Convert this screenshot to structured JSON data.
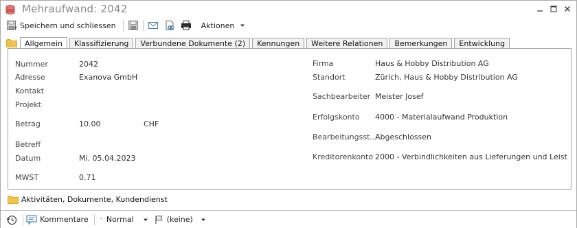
{
  "window": {
    "title": "Mehraufwand: 2042"
  },
  "toolbar": {
    "save_close_label": "Speichern und schliessen",
    "actions_label": "Aktionen"
  },
  "tabs": [
    {
      "label": "Allgemein",
      "active": true
    },
    {
      "label": "Klassifizierung"
    },
    {
      "label": "Verbundene Dokumente (2)"
    },
    {
      "label": "Kennungen"
    },
    {
      "label": "Weitere Relationen"
    },
    {
      "label": "Bemerkungen"
    },
    {
      "label": "Entwicklung"
    }
  ],
  "fields": {
    "nummer_label": "Nummer",
    "nummer_value": "2042",
    "adresse_label": "Adresse",
    "adresse_value": "Exanova GmbH",
    "kontakt_label": "Kontakt",
    "projekt_label": "Projekt",
    "betrag_label": "Betrag",
    "betrag_value": "10.00",
    "currency_value": "CHF",
    "betreff_label": "Betreff",
    "datum_label": "Datum",
    "datum_value": "Mi. 05.04.2023",
    "mwst_label": "MWST",
    "mwst_value": "0.71",
    "firma_label": "Firma",
    "firma_value": "Haus & Hobby Distribution AG",
    "standort_label": "Standort",
    "standort_value": "Zürich, Haus & Hobby Distribution AG",
    "sachbearbeiter_label": "Sachbearbeiter",
    "sachbearbeiter_value": "Meister Josef",
    "erfolgskonto_label": "Erfolgskonto",
    "erfolgskonto_value": "4000  -  Materialaufwand Produktion",
    "bearbeitungsstatus_label": "Bearbeitungsst...",
    "bearbeitungsstatus_value": "Abgeschlossen",
    "kreditorenkonto_label": "Kreditorenkonto",
    "kreditorenkonto_value": "2000   -   Verbindlichkeiten aus Lieferungen und Leistun"
  },
  "section": {
    "label": "Aktivitäten, Dokumente, Kundendienst"
  },
  "statusbar": {
    "comments_label": "Kommentare",
    "priority_label": "Normal",
    "flag_label": "(keine)"
  },
  "colors": {
    "folder": "#f5c242",
    "title_icon": "#d9534f",
    "window_border": "#a9a9a9"
  }
}
